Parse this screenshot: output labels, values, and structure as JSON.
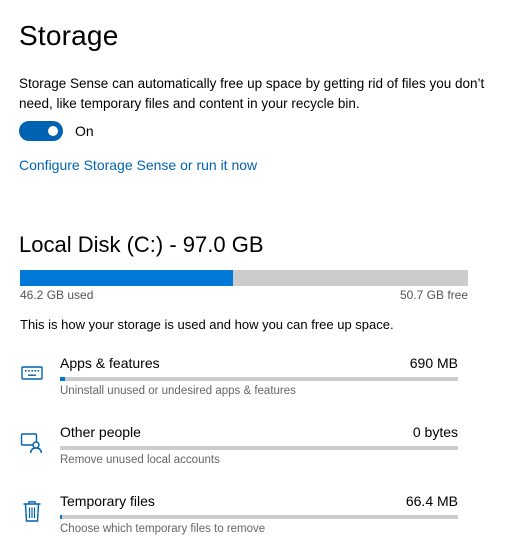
{
  "page": {
    "title": "Storage",
    "description": "Storage Sense can automatically free up space by getting rid of files you don’t need, like temporary files and content in your recycle bin."
  },
  "storage_sense": {
    "toggle_state": "On",
    "toggle_on": true,
    "configure_link": "Configure Storage Sense or run it now"
  },
  "disk": {
    "title": "Local Disk (C:) - 97.0 GB",
    "used_label": "46.2 GB used",
    "free_label": "50.7 GB free",
    "used_fraction": 0.476,
    "usage_caption": "This is how your storage is used and how you can free up space."
  },
  "categories": [
    {
      "name": "Apps & features",
      "size": "690 MB",
      "description": "Uninstall unused or undesired apps & features",
      "icon": "keyboard-icon",
      "used_fraction": 0.012
    },
    {
      "name": "Other people",
      "size": "0 bytes",
      "description": "Remove unused local accounts",
      "icon": "people-icon",
      "used_fraction": 0
    },
    {
      "name": "Temporary files",
      "size": "66.4 MB",
      "description": "Choose which temporary files to remove",
      "icon": "trash-icon",
      "used_fraction": 0.002
    }
  ],
  "colors": {
    "accent": "#0063b1",
    "bar_fill": "#0078d7",
    "bar_track": "#cccccc"
  }
}
